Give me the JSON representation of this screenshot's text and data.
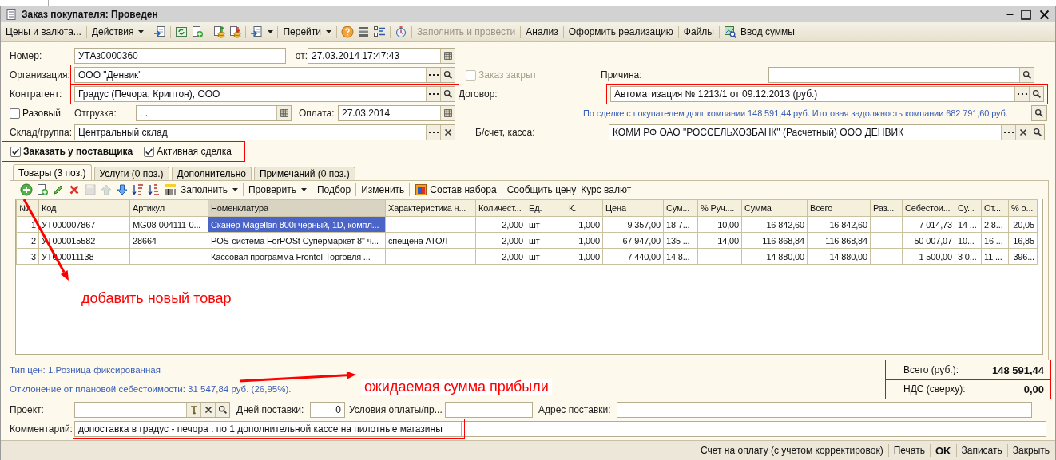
{
  "window": {
    "title": "Заказ покупателя: Проведен"
  },
  "toolbar": [
    {
      "kind": "button",
      "label": "Цены и валюта...",
      "disabled": false
    },
    {
      "kind": "separator"
    },
    {
      "kind": "menu",
      "label": "Действия",
      "disabled": false
    },
    {
      "kind": "separator"
    },
    {
      "kind": "icon",
      "disabled": false
    },
    {
      "kind": "separator"
    },
    {
      "kind": "icon",
      "disabled": false
    },
    {
      "kind": "icon",
      "disabled": false
    },
    {
      "kind": "separator"
    },
    {
      "kind": "icon",
      "disabled": false
    },
    {
      "kind": "icon",
      "disabled": false
    },
    {
      "kind": "separator"
    },
    {
      "kind": "icon_menu",
      "disabled": false
    },
    {
      "kind": "separator"
    },
    {
      "kind": "menu",
      "label": "Перейти",
      "disabled": false
    },
    {
      "kind": "separator"
    },
    {
      "kind": "icon",
      "disabled": false
    },
    {
      "kind": "icon",
      "disabled": false
    },
    {
      "kind": "icon",
      "disabled": false
    },
    {
      "kind": "separator"
    },
    {
      "kind": "icon",
      "disabled": false
    },
    {
      "kind": "separator"
    },
    {
      "kind": "button",
      "label": "Заполнить и провести",
      "disabled": true
    },
    {
      "kind": "separator"
    },
    {
      "kind": "button",
      "label": "Анализ",
      "disabled": false
    },
    {
      "kind": "separator"
    },
    {
      "kind": "button",
      "label": "Оформить реализацию",
      "disabled": false
    },
    {
      "kind": "separator"
    },
    {
      "kind": "button",
      "label": "Файлы",
      "disabled": false
    },
    {
      "kind": "separator"
    },
    {
      "kind": "icon",
      "disabled": false
    },
    {
      "kind": "button",
      "label": "Ввод суммы",
      "disabled": false
    }
  ],
  "form": {
    "number": {
      "label": "Номер:",
      "value": "УТАз0000360"
    },
    "date": {
      "label": "от:",
      "value": "27.03.2014 17:47:43",
      "kind": "date"
    },
    "organization": {
      "label": "Организация:",
      "value": "ООО \"Денвик\"",
      "kind": "lookup",
      "annotated": true
    },
    "order_closed": {
      "label": "Заказ закрыт",
      "checked": false,
      "disabled": true
    },
    "reason": {
      "label": "Причина:",
      "kind": "search",
      "annotated": false
    },
    "counterparty": {
      "label": "Контрагент:",
      "value": "Градус (Печора, Криптон), ООО",
      "kind": "lookup",
      "annotated": true
    },
    "contract": {
      "label": "Договор:",
      "value": "Автоматизация № 1213/1 от 09.12.2013 (руб.)",
      "kind": "lookup",
      "annotated": true
    },
    "one_time": {
      "label": "Разовый",
      "checked": false,
      "disabled": false
    },
    "shipment": {
      "label": "Отгрузка:",
      "value": " .  .",
      "kind": "date"
    },
    "payment": {
      "label": "Оплата:",
      "value": "27.03.2014",
      "kind": "date"
    },
    "debt_info": "По сделке с покупателем долг компании 148 591,44 руб. Итоговая задолжность компании 682 791,60 руб.",
    "warehouse": {
      "label": "Склад/группа:",
      "value": "Центральный склад",
      "kind": "lookup_clear"
    },
    "account": {
      "label": "Б/счет, касса:",
      "value": "КОМИ РФ ОАО \"РОССЕЛЬХОЗБАНК\" (Расчетный) ООО ДЕНВИК",
      "kind": "lookup_clear_search"
    },
    "flags": {
      "annotated": true,
      "items": [
        {
          "label": "Заказать у поставщика",
          "checked": true,
          "bold": true
        },
        {
          "label": "Активная сделка",
          "checked": true,
          "bold": false
        }
      ]
    }
  },
  "tabs": [
    {
      "label": "Товары (3 поз.)",
      "selected": true
    },
    {
      "label": "Услуги (0 поз.)",
      "selected": false
    },
    {
      "label": "Дополнительно",
      "selected": false
    },
    {
      "label": "Примечаний (0 поз.)",
      "selected": false
    }
  ],
  "table_toolbar": [
    {
      "kind": "icon",
      "disabled": false
    },
    {
      "kind": "icon",
      "disabled": false
    },
    {
      "kind": "icon",
      "disabled": false
    },
    {
      "kind": "icon",
      "disabled": false
    },
    {
      "kind": "icon",
      "disabled": true
    },
    {
      "kind": "icon",
      "disabled": true
    },
    {
      "kind": "icon",
      "disabled": false
    },
    {
      "kind": "icon",
      "disabled": false
    },
    {
      "kind": "icon",
      "disabled": false
    },
    {
      "kind": "icon",
      "disabled": false
    },
    {
      "kind": "menu",
      "label": "Заполнить",
      "disabled": false
    },
    {
      "kind": "separator"
    },
    {
      "kind": "menu",
      "label": "Проверить",
      "disabled": false
    },
    {
      "kind": "separator"
    },
    {
      "kind": "button",
      "label": "Подбор",
      "disabled": false
    },
    {
      "kind": "separator"
    },
    {
      "kind": "button",
      "label": "Изменить",
      "disabled": false
    },
    {
      "kind": "separator"
    },
    {
      "kind": "icon_button",
      "label": "Состав набора",
      "disabled": false
    },
    {
      "kind": "separator"
    },
    {
      "kind": "button",
      "label": "Сообщить цену",
      "disabled": false
    },
    {
      "kind": "button",
      "label": "Курс валют",
      "disabled": false
    }
  ],
  "table": {
    "columns": [
      {
        "label": "№",
        "highlighted": false
      },
      {
        "label": "Код",
        "highlighted": false
      },
      {
        "label": "Артикул",
        "highlighted": false
      },
      {
        "label": "Номенклатура",
        "highlighted": true
      },
      {
        "label": "Характеристика н...",
        "highlighted": false
      },
      {
        "label": "Количест...",
        "highlighted": false
      },
      {
        "label": "Ед.",
        "highlighted": false
      },
      {
        "label": "К.",
        "highlighted": false
      },
      {
        "label": "Цена",
        "highlighted": false
      },
      {
        "label": "Сум...",
        "highlighted": false
      },
      {
        "label": "% Руч....",
        "highlighted": false
      },
      {
        "label": "Сумма",
        "highlighted": false
      },
      {
        "label": "Всего",
        "highlighted": false
      },
      {
        "label": "Раз...",
        "highlighted": false
      },
      {
        "label": "Себестои...",
        "highlighted": false
      },
      {
        "label": "Су...",
        "highlighted": false
      },
      {
        "label": "От...",
        "highlighted": false
      },
      {
        "label": "% о...",
        "highlighted": false
      }
    ],
    "rows": [
      {
        "selected": true,
        "cells": [
          "1",
          "УТ000007867",
          "MG08-004111-0...",
          "Сканер Magellan 800i черный, 1D, компл...",
          "",
          "2,000",
          "шт",
          "1,000",
          "9 357,00",
          "18 7...",
          "10,00",
          "16 842,60",
          "16 842,60",
          "",
          "7 014,73",
          "14 ...",
          "2 8...",
          "20,05"
        ]
      },
      {
        "selected": false,
        "cells": [
          "2",
          "УТ000015582",
          "28664",
          "POS-система ForPOSt Супермаркет 8\" ч...",
          "спещена АТОЛ",
          "2,000",
          "шт",
          "1,000",
          "67 947,00",
          "135 ...",
          "14,00",
          "116 868,84",
          "116 868,84",
          "",
          "50 007,07",
          "10...",
          "16 ...",
          "16,85"
        ]
      },
      {
        "selected": false,
        "cells": [
          "3",
          "УТ000011138",
          "",
          "Кассовая программа Frontol-Торговля ...",
          "",
          "2,000",
          "шт",
          "1,000",
          "7 440,00",
          "14 8...",
          "",
          "14 880,00",
          "14 880,00",
          "",
          "1 500,00",
          "3 0...",
          "11 ...",
          "396..."
        ]
      }
    ]
  },
  "price_type": "Тип цен: 1.Розница фиксированная",
  "deviation": "Отклонение от плановой себестоимости: 31 547,84 руб. (26,95%).",
  "totals": [
    {
      "label": "Всего (руб.):",
      "value": "148 591,44",
      "annotated": true
    },
    {
      "label": "НДС (сверху):",
      "value": "0,00",
      "annotated": true
    }
  ],
  "project": {
    "label": "Проект:",
    "kind": "project"
  },
  "delivery_days": {
    "label": "Дней поставки:",
    "value": "0"
  },
  "payment_terms": {
    "label": "Условия оплаты/пр..."
  },
  "address": {
    "label": "Адрес поставки:"
  },
  "comment": {
    "label": "Комментарий:",
    "value": "допоставка в градус - печора . по 1 дополнительной кассе на пилотные магазины",
    "annotated": true
  },
  "footer_buttons": [
    {
      "label": "Счет на оплату (с учетом корректировок)",
      "default": false
    },
    {
      "label": "Печать",
      "default": false
    },
    {
      "label": "OK",
      "default": true
    },
    {
      "label": "Записать",
      "default": false
    },
    {
      "label": "Закрыть",
      "default": false
    }
  ],
  "annotations": [
    {
      "text": "добавить новый товар"
    },
    {
      "text": "ожидаемая сумма прибыли"
    }
  ]
}
